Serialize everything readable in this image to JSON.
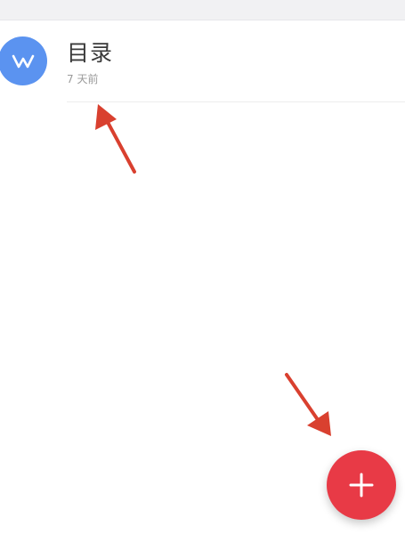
{
  "document": {
    "title": "目录",
    "modified": "7 天前",
    "avatar_icon": "w-document-icon",
    "avatar_color": "#5b93f0"
  },
  "fab": {
    "icon": "plus-icon",
    "color": "#e83a46"
  },
  "annotations": {
    "arrow_color": "#d9402f"
  }
}
